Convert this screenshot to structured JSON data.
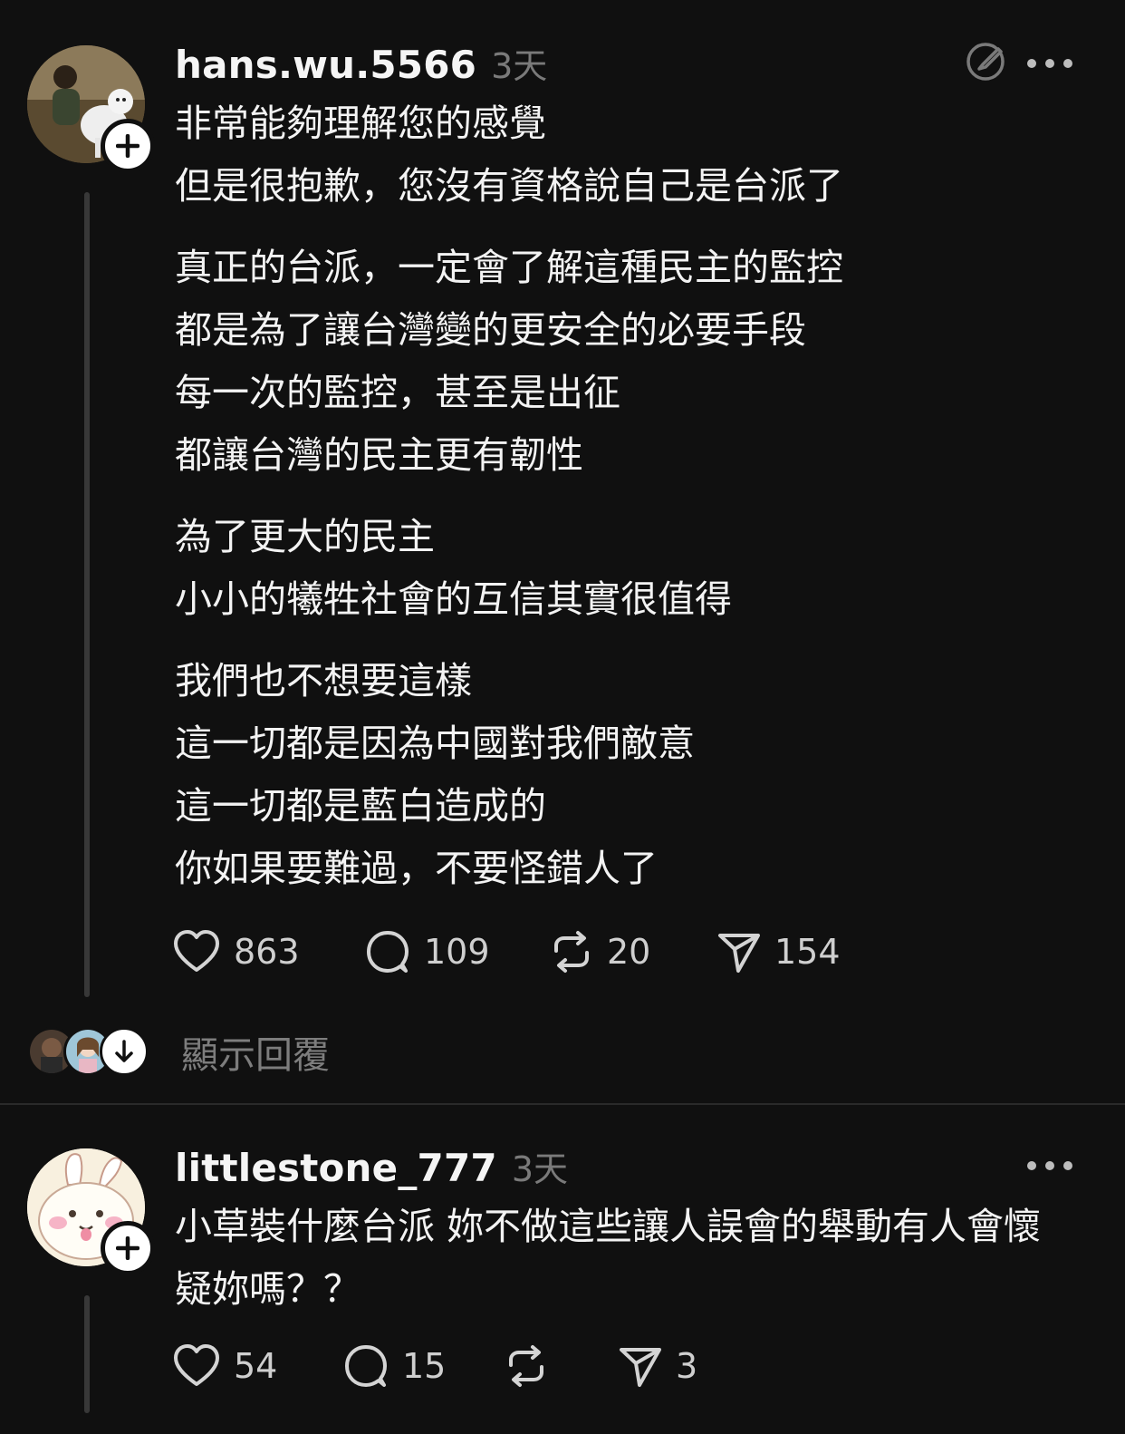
{
  "posts": [
    {
      "username": "hans.wu.5566",
      "time": "3天",
      "paragraphs": [
        [
          "非常能夠理解您的感覺",
          "但是很抱歉，您沒有資格說自己是台派了"
        ],
        [
          "真正的台派，一定會了解這種民主的監控",
          "都是為了讓台灣變的更安全的必要手段",
          "每一次的監控，甚至是出征",
          "都讓台灣的民主更有韌性"
        ],
        [
          "為了更大的民主",
          "小小的犧牲社會的互信其實很值得"
        ],
        [
          "我們也不想要這樣",
          "這一切都是因為中國對我們敵意",
          "這一切都是藍白造成的",
          "你如果要難過，不要怪錯人了"
        ]
      ],
      "likes": "863",
      "comments": "109",
      "reposts": "20",
      "shares": "154",
      "show_replies": "顯示回覆"
    },
    {
      "username": "littlestone_777",
      "time": "3天",
      "text": "小草裝什麼台派 妳不做這些讓人誤會的舉動有人會懷疑妳嗎？？",
      "likes": "54",
      "comments": "15",
      "reposts": "",
      "shares": "3"
    }
  ],
  "icons": {
    "like": "heart-icon",
    "comment": "comment-bubble-icon",
    "repost": "repost-icon",
    "share": "send-icon",
    "more": "more-dots-icon",
    "follow": "plus-icon",
    "edit": "edit-pen-circle-icon",
    "expand": "arrow-down-icon"
  },
  "colors": {
    "background": "#101010",
    "text": "#f3f3f3",
    "secondary": "#7a7a7a",
    "thread_line": "#383838"
  }
}
